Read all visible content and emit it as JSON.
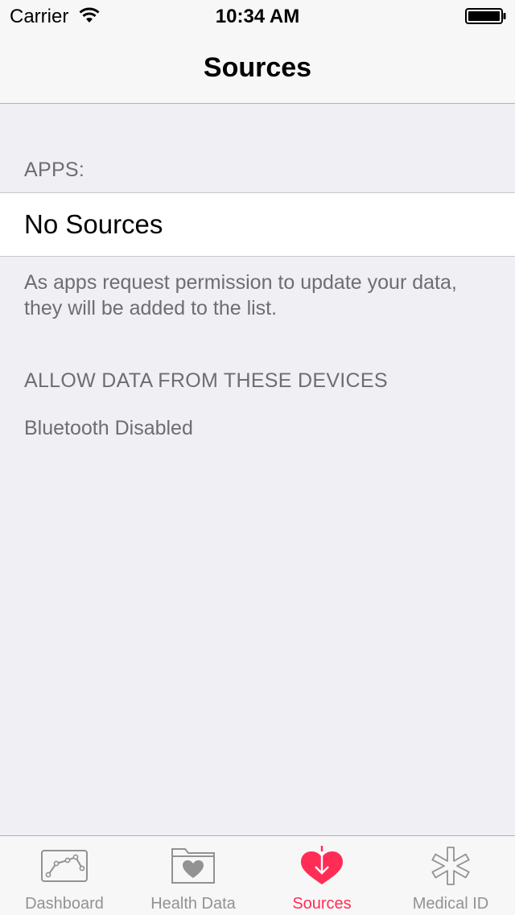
{
  "status_bar": {
    "carrier": "Carrier",
    "time": "10:34 AM",
    "icons": [
      "wifi-icon",
      "battery-icon"
    ]
  },
  "nav": {
    "title": "Sources"
  },
  "apps_section": {
    "header": "APPS:",
    "cell_label": "No Sources",
    "footer": "As apps request permission to update your data, they will be added to the list."
  },
  "devices_section": {
    "header": "ALLOW DATA FROM THESE DEVICES",
    "status": "Bluetooth Disabled"
  },
  "tab_bar": {
    "accent_color": "#ff2d55",
    "inactive_color": "#929292",
    "tabs": [
      {
        "label": "Dashboard",
        "icon": "dashboard-chart-icon",
        "active": false
      },
      {
        "label": "Health Data",
        "icon": "health-data-folder-icon",
        "active": false
      },
      {
        "label": "Sources",
        "icon": "sources-heart-icon",
        "active": true
      },
      {
        "label": "Medical ID",
        "icon": "medical-id-asterisk-icon",
        "active": false
      }
    ]
  }
}
